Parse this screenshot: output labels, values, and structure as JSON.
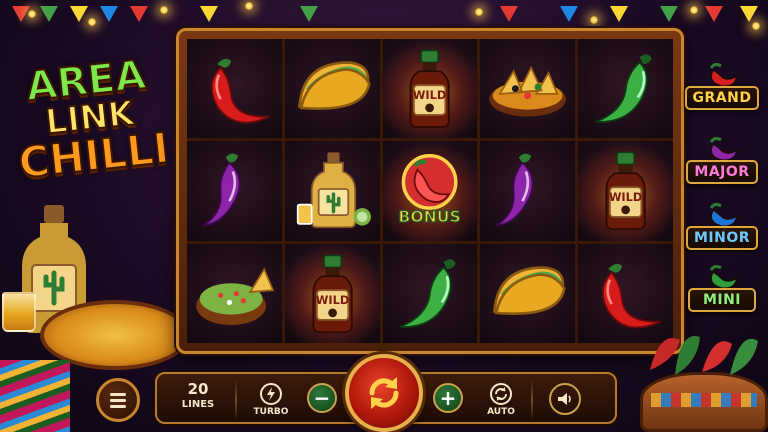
{
  "game": {
    "logo": {
      "line1": "AREA",
      "line2": "LINK",
      "line3": "CHILLI"
    }
  },
  "reels": {
    "rows": [
      [
        "red-chili",
        "taco",
        "wild",
        "nachos",
        "green-chili"
      ],
      [
        "purple-chili",
        "tequila",
        "bonus",
        "purple-chili",
        "wild"
      ],
      [
        "guacamole",
        "wild",
        "green-chili",
        "taco",
        "red-chili"
      ]
    ],
    "wild_label": "WILD",
    "bonus_label": "BONUS"
  },
  "jackpots": [
    {
      "label": "GRAND",
      "color": "#ffd24a",
      "chili_color": "#d41f1f"
    },
    {
      "label": "MAJOR",
      "color": "#ff7ad9",
      "chili_color": "#8e24aa"
    },
    {
      "label": "MINOR",
      "color": "#6ec8ff",
      "chili_color": "#1e73d6"
    },
    {
      "label": "MINI",
      "color": "#8ef07a",
      "chili_color": "#2e9e3a"
    }
  ],
  "controls": {
    "lines_value": "20",
    "lines_label": "LINES",
    "turbo_label": "TURBO",
    "minus_label": "−",
    "plus_label": "+",
    "auto_label": "AUTO"
  },
  "colors": {
    "accent_gold": "#e0a83a",
    "spin_red": "#b0180c"
  }
}
